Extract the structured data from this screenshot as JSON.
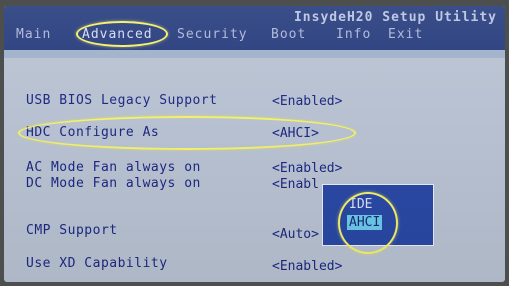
{
  "header": {
    "title": "InsydeH20 Setup Utility",
    "tabs": [
      {
        "label": "Main"
      },
      {
        "label": "Advanced",
        "active": true
      },
      {
        "label": "Security"
      },
      {
        "label": "Boot"
      },
      {
        "label": "Info"
      },
      {
        "label": "Exit"
      }
    ]
  },
  "settings": [
    {
      "label": "USB BIOS Legacy Support",
      "value": "<Enabled>"
    },
    {
      "label": "HDC Configure As",
      "value": "<AHCI>"
    },
    {
      "label": "AC Mode Fan always on",
      "value": "<Enabled>"
    },
    {
      "label": "DC Mode Fan always on",
      "value": "<Enabl"
    },
    {
      "label": "CMP Support",
      "value": "<Auto>"
    },
    {
      "label": "Use XD Capability",
      "value": "<Enabled>"
    }
  ],
  "popup": {
    "options": [
      "IDE",
      "AHCI"
    ],
    "selected": "AHCI"
  },
  "colors": {
    "header_bg": "#243a7c",
    "body_bg": "#b7c1d1",
    "text": "#1d2880",
    "highlight": "#6cc8e8",
    "annotation": "#f3f069"
  }
}
